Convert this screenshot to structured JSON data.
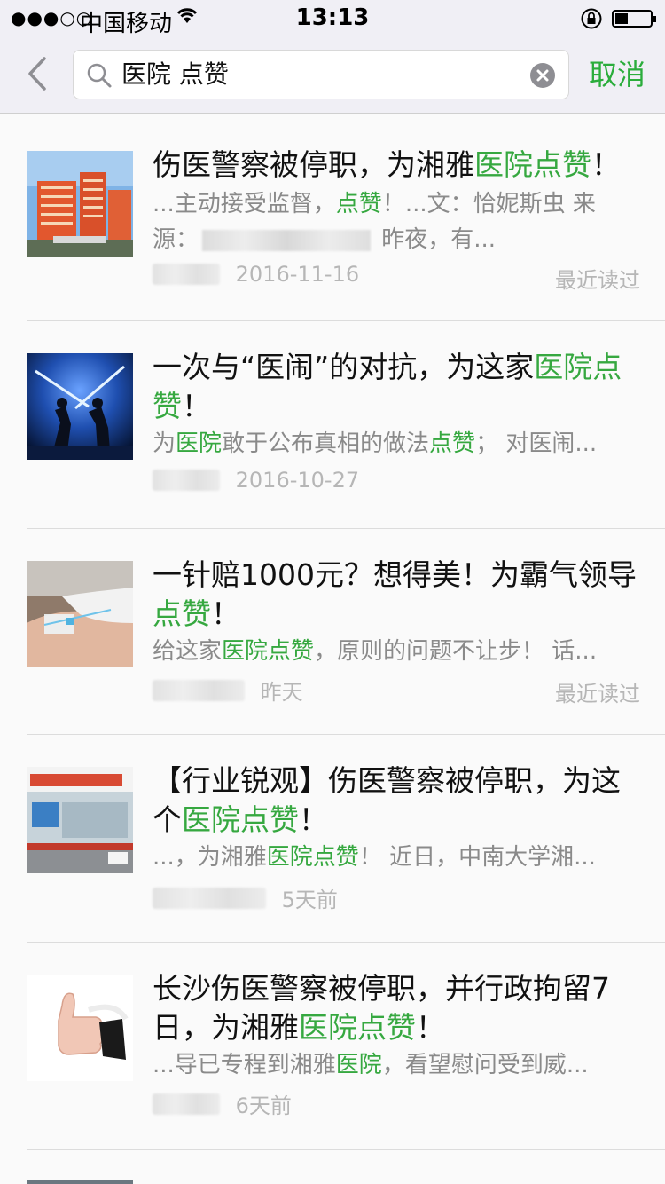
{
  "status_bar": {
    "signal": "●●●○○",
    "carrier": "中国移动",
    "time": "13:13"
  },
  "search": {
    "query": "医院 点赞",
    "cancel_label": "取消"
  },
  "results": [
    {
      "title_segments": [
        {
          "text": "伤医警察被停职，为湘雅",
          "hl": false
        },
        {
          "text": "医院点赞",
          "hl": true
        },
        {
          "text": "！",
          "hl": false
        }
      ],
      "snippet_segments": [
        {
          "text": "...主动接受监督，",
          "hl": false
        },
        {
          "text": "点赞",
          "hl": true
        },
        {
          "text": "！...文：恰妮斯虫 来源：",
          "hl": false
        },
        {
          "text": "████████",
          "hl": false,
          "blur": true
        },
        {
          "text": " 昨夜，有...",
          "hl": false
        }
      ],
      "date": "2016-11-16",
      "read_label": "最近读过",
      "thumb": "hospital-building"
    },
    {
      "title_segments": [
        {
          "text": "一次与“医闹”的对抗，为这家",
          "hl": false
        },
        {
          "text": "医院点赞",
          "hl": true
        },
        {
          "text": "！",
          "hl": false
        }
      ],
      "snippet_segments": [
        {
          "text": "为",
          "hl": false
        },
        {
          "text": "医院",
          "hl": true
        },
        {
          "text": "敢于公布真相的做法",
          "hl": false
        },
        {
          "text": "点赞",
          "hl": true
        },
        {
          "text": "； 对医闹...",
          "hl": false
        }
      ],
      "date": "2016-10-27",
      "read_label": "",
      "thumb": "lightsaber-duel"
    },
    {
      "title_segments": [
        {
          "text": "一针赔1000元？想得美！为霸气领导",
          "hl": false
        },
        {
          "text": "点赞",
          "hl": true
        },
        {
          "text": "！",
          "hl": false
        }
      ],
      "snippet_segments": [
        {
          "text": "给这家",
          "hl": false
        },
        {
          "text": "医院点赞",
          "hl": true
        },
        {
          "text": "，原则的问题不让步！ 话...",
          "hl": false
        }
      ],
      "date": "昨天",
      "read_label": "最近读过",
      "thumb": "iv-injection"
    },
    {
      "title_segments": [
        {
          "text": "【行业锐观】伤医警察被停职，为这个",
          "hl": false
        },
        {
          "text": "医院点赞",
          "hl": true
        },
        {
          "text": "！",
          "hl": false
        }
      ],
      "snippet_segments": [
        {
          "text": "...，为湘雅",
          "hl": false
        },
        {
          "text": "医院点赞",
          "hl": true
        },
        {
          "text": "！ 近日，中南大学湘...",
          "hl": false
        }
      ],
      "date": "5天前",
      "read_label": "",
      "thumb": "hospital-entrance"
    },
    {
      "title_segments": [
        {
          "text": "长沙伤医警察被停职，并行政拘留7日，为湘雅",
          "hl": false
        },
        {
          "text": "医院点赞",
          "hl": true
        },
        {
          "text": "！",
          "hl": false
        }
      ],
      "snippet_segments": [
        {
          "text": "...导已专程到湘雅",
          "hl": false
        },
        {
          "text": "医院",
          "hl": true
        },
        {
          "text": "，看望慰问受到威...",
          "hl": false
        }
      ],
      "date": "6天前",
      "read_label": "",
      "thumb": "thumbs-up"
    }
  ]
}
